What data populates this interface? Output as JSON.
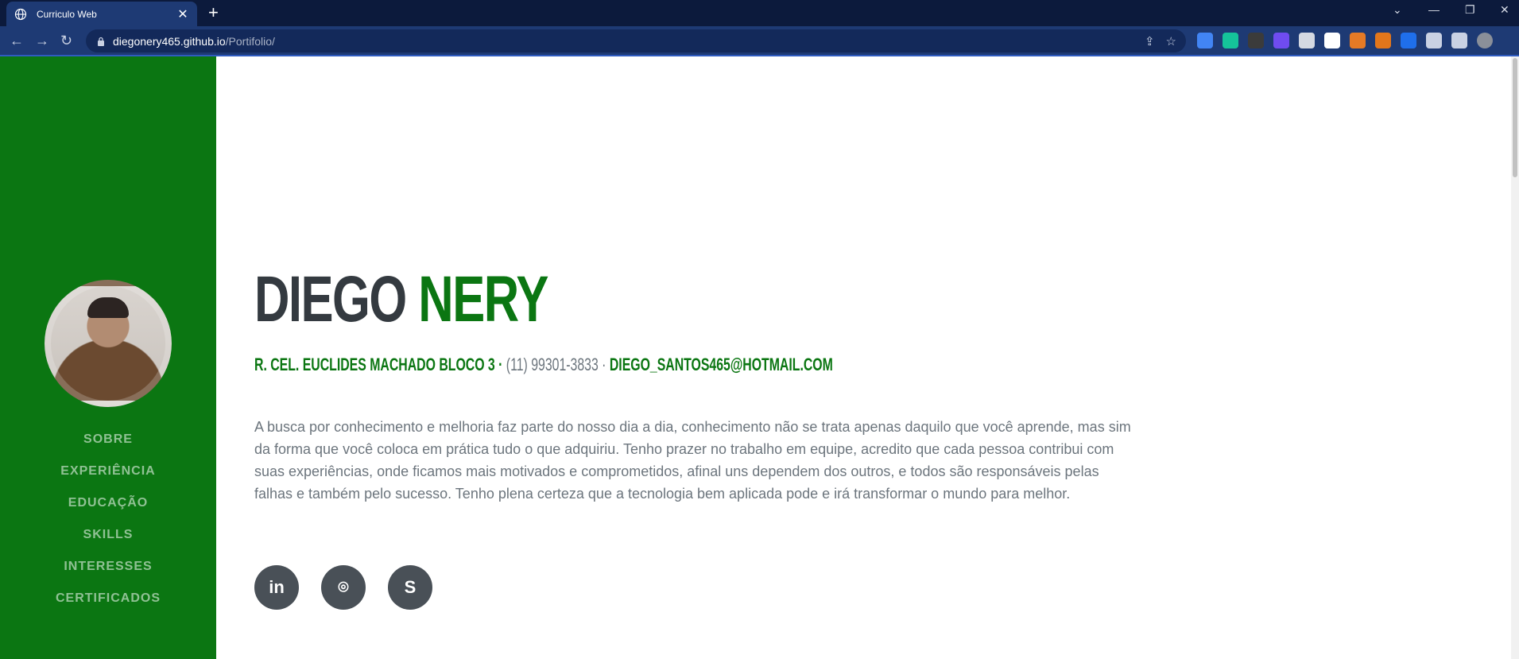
{
  "browser": {
    "tab_title": "Curriculo Web",
    "tab_close": "✕",
    "new_tab": "+",
    "url_host": "diegonery465.github.io",
    "url_path": "/Portifolio/",
    "back": "←",
    "forward": "→",
    "reload": "↻",
    "window_controls": [
      "⌄",
      "—",
      "❐",
      "✕"
    ],
    "extensions": [
      {
        "name": "google-translate-icon",
        "color": "#4285f4"
      },
      {
        "name": "grammarly-icon",
        "color": "#15c39a"
      },
      {
        "name": "extension-icon-3",
        "color": "#3b3b3b"
      },
      {
        "name": "extension-icon-4",
        "color": "#6f4cf0"
      },
      {
        "name": "extension-icon-5",
        "color": "#d5d9e2"
      },
      {
        "name": "extension-icon-ads",
        "color": "#ffffff"
      },
      {
        "name": "extension-icon-ds",
        "color": "#e57a26"
      },
      {
        "name": "metamask-icon",
        "color": "#e2761b"
      },
      {
        "name": "extension-icon-x",
        "color": "#1f6feb"
      },
      {
        "name": "puzzle-icon",
        "color": "#c9d1e3"
      },
      {
        "name": "sidebar-icon",
        "color": "#c9d1e3"
      },
      {
        "name": "profile-avatar-icon",
        "color": "#8a8f99"
      }
    ]
  },
  "sidebar": {
    "nav": [
      {
        "label": "SOBRE"
      },
      {
        "label": "EXPERIÊNCIA"
      },
      {
        "label": "EDUCAÇÃO"
      },
      {
        "label": "SKILLS"
      },
      {
        "label": "INTERESSES"
      },
      {
        "label": "CERTIFICADOS"
      }
    ]
  },
  "profile": {
    "first_name": "DIEGO",
    "last_name": "NERY",
    "address": "R. CEL. EUCLIDES MACHADO BLOCO 3 · ",
    "phone": "(11) 99301-3833 · ",
    "email": "DIEGO_SANTOS465@HOTMAIL.COM",
    "bio": "A busca por conhecimento e melhoria faz parte do nosso dia a dia, conhecimento não se trata apenas daquilo que você aprende, mas sim da forma que você coloca em prática tudo o que adquiriu. Tenho prazer no trabalho em equipe, acredito que cada pessoa contribui com suas experiências, onde ficamos mais motivados e comprometidos, afinal uns dependem dos outros, e todos são responsáveis pelas falhas e também pelo sucesso. Tenho plena certeza que a tecnologia bem aplicada pode e irá transformar o mundo para melhor."
  },
  "socials": [
    {
      "icon": "linkedin-icon",
      "glyph": "in"
    },
    {
      "icon": "github-icon",
      "glyph": "⌾"
    },
    {
      "icon": "skype-icon",
      "glyph": "S"
    }
  ],
  "colors": {
    "primary": "#0b7612",
    "dark": "#343a40",
    "muted": "#6c757d"
  }
}
